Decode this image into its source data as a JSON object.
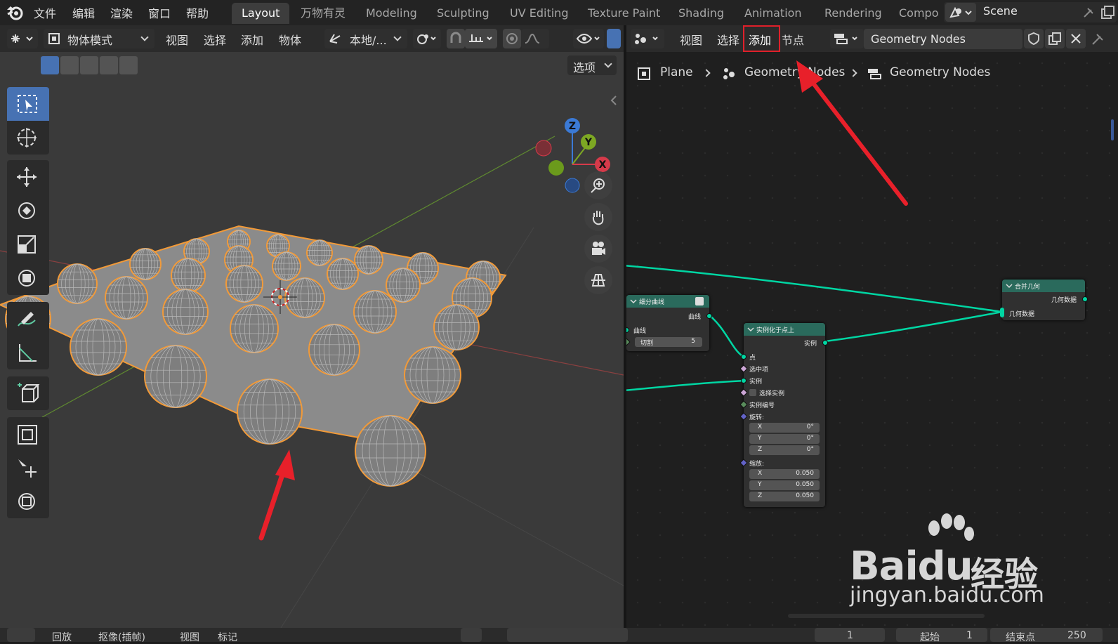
{
  "menu": {
    "file": "文件",
    "edit": "编辑",
    "render": "渲染",
    "window": "窗口",
    "help": "帮助"
  },
  "workspaces": [
    "Layout",
    "万物有灵",
    "Modeling",
    "Sculpting",
    "UV Editing",
    "Texture Paint",
    "Shading",
    "Animation",
    "Rendering",
    "Compo"
  ],
  "active_workspace": "Layout",
  "scene": {
    "name": "Scene"
  },
  "viewport": {
    "mode": "物体模式",
    "menu": [
      "视图",
      "选择",
      "添加",
      "物体"
    ],
    "transform_orientation": "本地/...",
    "options": "选项",
    "gizmo": {
      "x": "X",
      "y": "Y",
      "z": "Z"
    }
  },
  "node_editor": {
    "menu": [
      "视图",
      "选择",
      "添加",
      "节点"
    ],
    "highlighted_menu": "添加",
    "datablock": "Geometry Nodes",
    "breadcrumb": [
      "Plane",
      "Geometry Nodes",
      "Geometry Nodes"
    ],
    "nodes": {
      "subdivide": {
        "title": "细分曲线",
        "out_curve": "曲线",
        "in_curve": "曲线",
        "cuts_label": "切割",
        "cuts_value": "5"
      },
      "instance": {
        "title": "实例化于点上",
        "out_instance": "实例",
        "points": "点",
        "selection": "选中项",
        "instance": "实例",
        "pick_instance": "选择实例",
        "instance_index": "实例编号",
        "rotation": "旋转:",
        "rot": [
          {
            "axis": "X",
            "value": "0°"
          },
          {
            "axis": "Y",
            "value": "0°"
          },
          {
            "axis": "Z",
            "value": "0°"
          }
        ],
        "scale": "缩放:",
        "scl": [
          {
            "axis": "X",
            "value": "0.050"
          },
          {
            "axis": "Y",
            "value": "0.050"
          },
          {
            "axis": "Z",
            "value": "0.050"
          }
        ]
      },
      "join": {
        "title": "合并几何",
        "out_geometry": "几何数据",
        "in_geometry": "几何数据"
      }
    }
  },
  "timeline": {
    "playback": "回放",
    "keying": "抠像(插帧)",
    "view": "视图",
    "marker": "标记",
    "current_frame": "1",
    "start_label": "起始",
    "start": "1",
    "end_label": "结束点",
    "end": "250"
  },
  "watermark": {
    "brand": "Bai",
    "brand_du": "du",
    "cn": "经验",
    "url": "jingyan.baidu.com"
  },
  "colors": {
    "accent": "#4772b3",
    "geometry_socket": "#00d6a3",
    "arrow": "#e8202a",
    "selection_outline": "#f29a38"
  }
}
